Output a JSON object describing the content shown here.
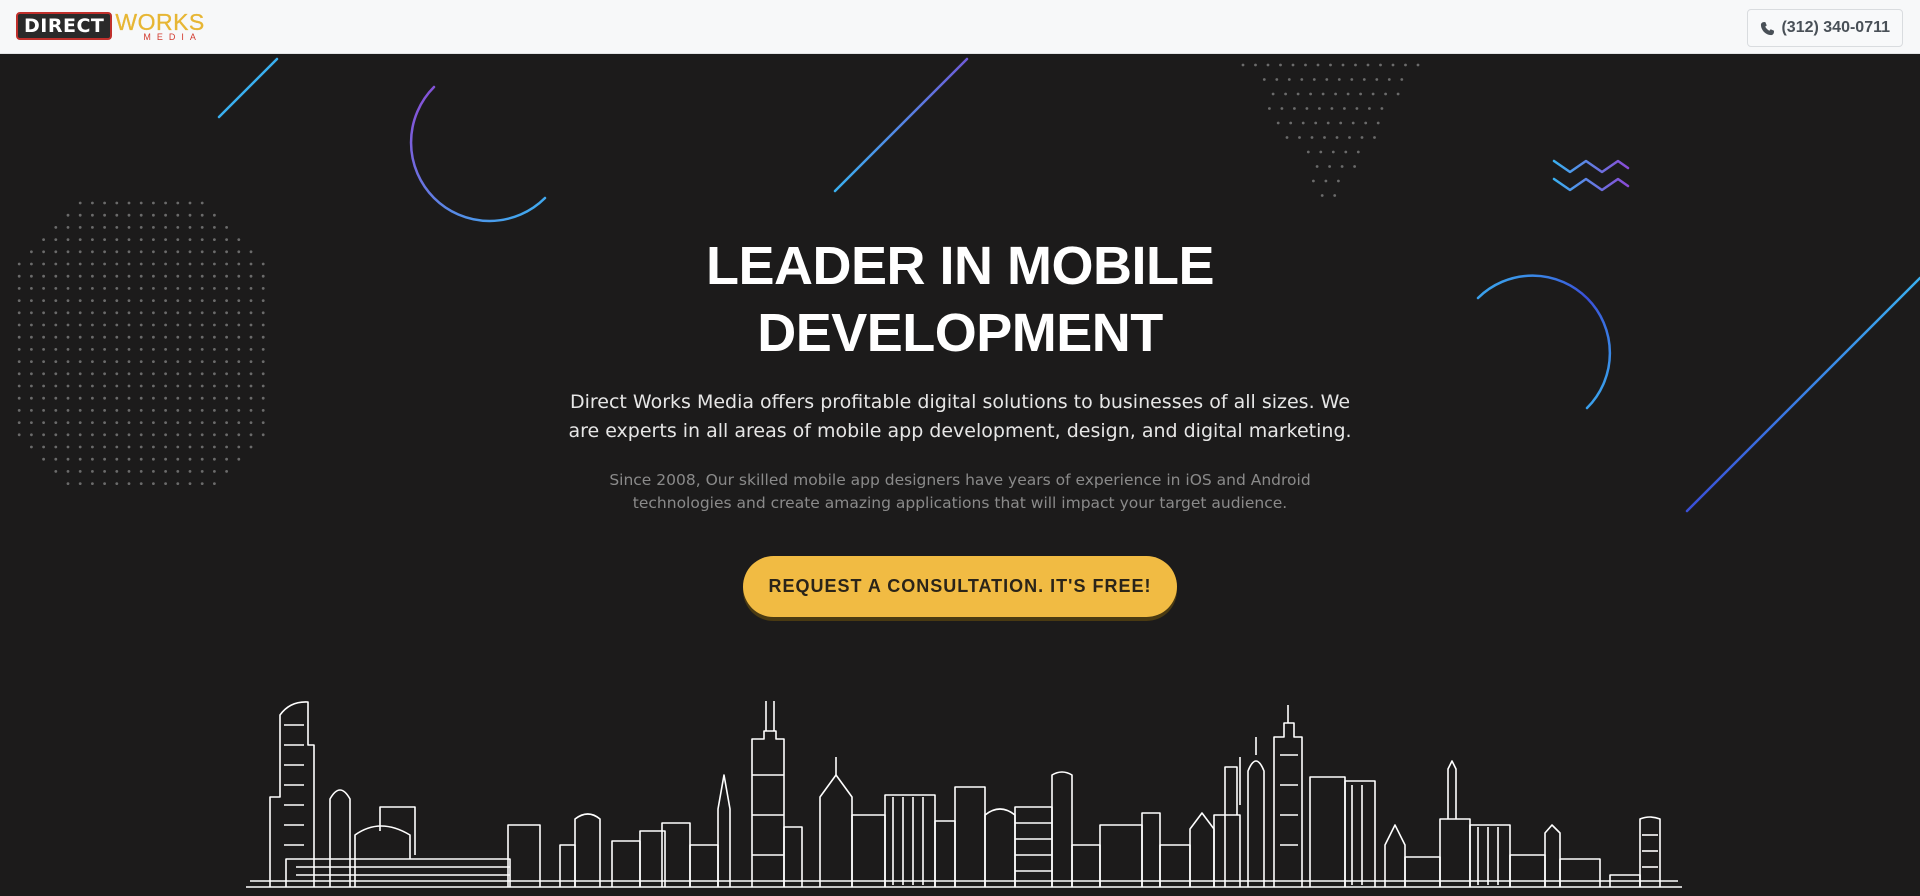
{
  "brand": {
    "logo_direct": "DIRECT",
    "logo_works": "WORKS",
    "logo_media": "MEDIA"
  },
  "header": {
    "phone_label": "(312) 340-0711",
    "phone_icon": "phone-icon"
  },
  "hero": {
    "headline_line1": "LEADER IN MOBILE",
    "headline_line2": "DEVELOPMENT",
    "lead_line1": "Direct Works Media offers profitable digital solutions to businesses of all sizes. We",
    "lead_line2": "are experts in all areas of mobile app development, design, and digital marketing.",
    "sub_line1": "Since 2008, Our skilled mobile app designers have years of experience in iOS and Android",
    "sub_line2": "technologies and create amazing applications that will impact your target audience.",
    "cta_label": "REQUEST A CONSULTATION. IT'S FREE!"
  },
  "colors": {
    "background": "#1c1b1b",
    "navbar": "#f7f8f9",
    "cta": "#f1bb43",
    "accent_blue": "#3ab0f0",
    "accent_purple": "#8a4bd6",
    "skyline": "#ffffff"
  }
}
